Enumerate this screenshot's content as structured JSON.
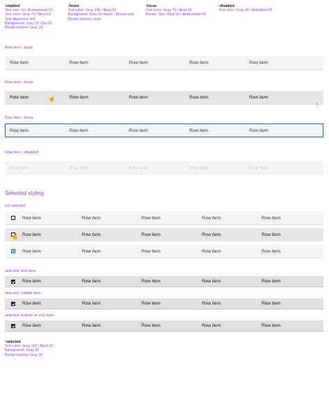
{
  "specs": [
    {
      "head": ":enabled",
      "lines": [
        "Text size: 14 / $component-01",
        "Text color: Gray 70 / $text-02",
        "Text alignment: left",
        "Background: Gray 10 / $ui-01",
        "Border-bottom: Gray 20"
      ]
    },
    {
      "head": ":hover",
      "lines": [
        "Text color: Gray 100 / $text-01",
        "Background: Gray 10 Hover / $hover-row",
        "Border-bottom: none"
      ]
    },
    {
      "head": ":focus",
      "lines": [
        "Text color: Gray 70 / $text-02",
        "Border: 2px / Blue 60 / $interactive-01"
      ]
    },
    {
      "head": ":disabled",
      "lines": [
        "Text color: Gray 30 / $disabled-02"
      ]
    }
  ],
  "states": {
    "basic_label": "Row item - basic",
    "hover_label": "Row item - hover",
    "focus_label": "Row item - focus",
    "disabled_label": "Row item - disabled"
  },
  "cell_text": "Row item",
  "selected_styling": {
    "title": "Selected styling",
    "not_selected_label": "not selected",
    "first_item_label": "selected: first item",
    "middle_item_label": "selected: middle item",
    "bottom_item_label": "selected: bottom or only item"
  },
  "selected_spec": {
    "head": ":selected",
    "lines": [
      "Text color: Gray 100 / $text-01",
      "Background: Gray 20",
      "Border-bottom: Gray 30"
    ]
  },
  "icons": {
    "cursor": "pointer-hand-icon",
    "overflow": "overflow-menu-icon"
  },
  "colors": {
    "accent": "#8a3ffc",
    "focus": "#0f62fe"
  }
}
